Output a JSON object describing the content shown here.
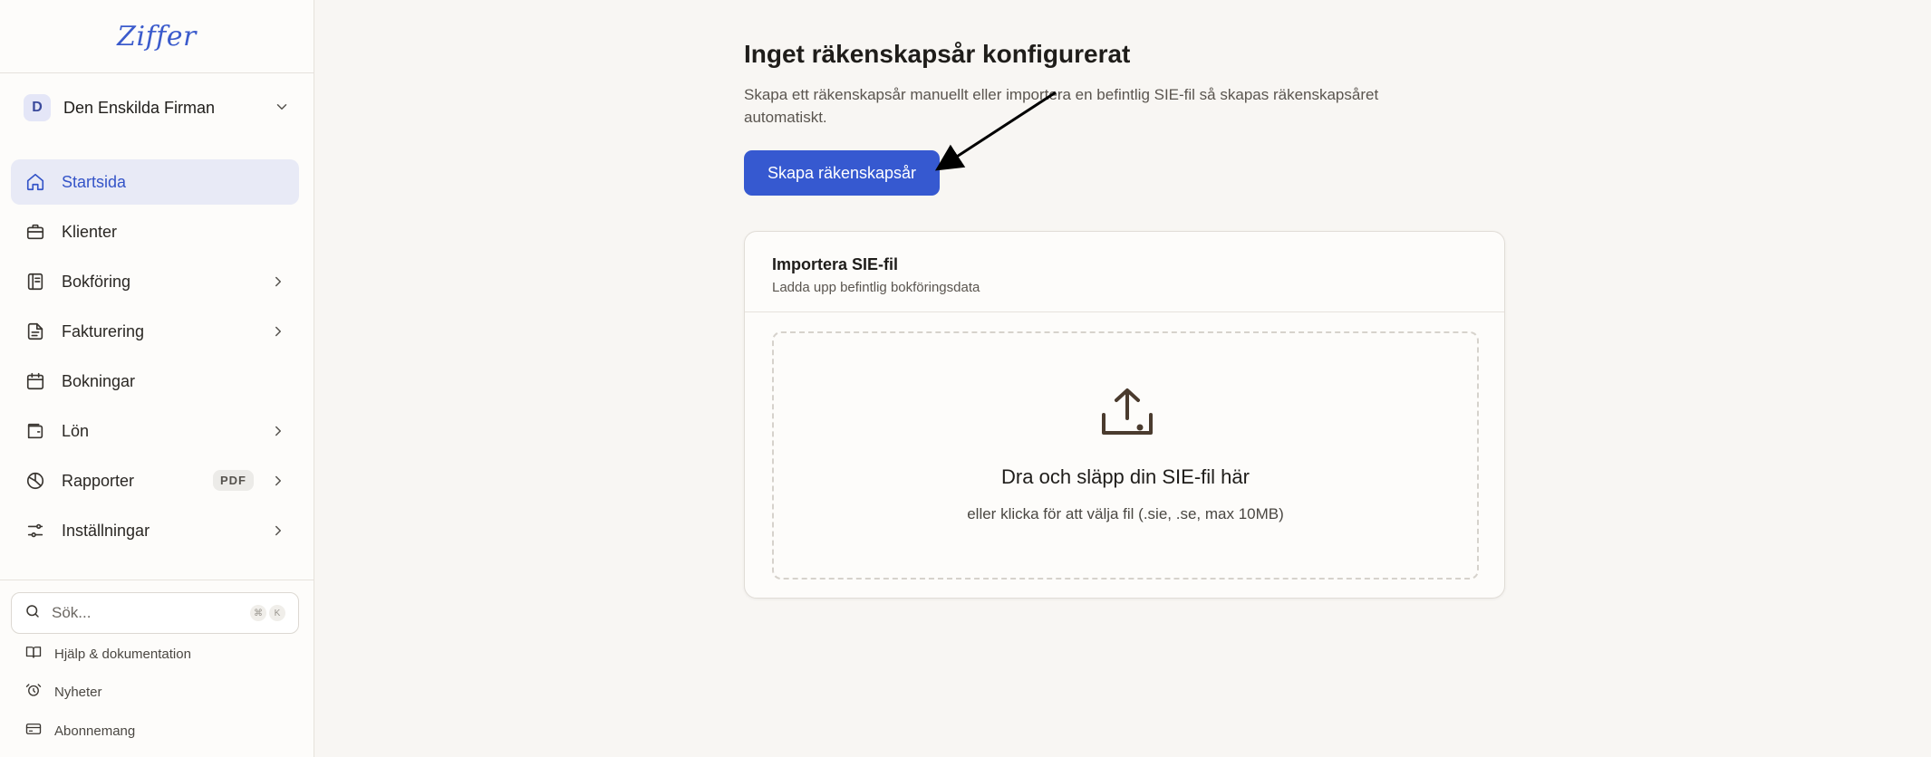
{
  "app": {
    "logo": "Ziffer"
  },
  "company": {
    "initial": "D",
    "name": "Den Enskilda Firman"
  },
  "nav": {
    "items": [
      {
        "label": "Startsida",
        "icon": "home-icon",
        "active": true,
        "chevron": false
      },
      {
        "label": "Klienter",
        "icon": "briefcase-icon",
        "active": false,
        "chevron": false
      },
      {
        "label": "Bokföring",
        "icon": "ledger-icon",
        "active": false,
        "chevron": true
      },
      {
        "label": "Fakturering",
        "icon": "document-icon",
        "active": false,
        "chevron": true
      },
      {
        "label": "Bokningar",
        "icon": "calendar-icon",
        "active": false,
        "chevron": false
      },
      {
        "label": "Lön",
        "icon": "wallet-icon",
        "active": false,
        "chevron": true
      },
      {
        "label": "Rapporter",
        "icon": "pie-chart-icon",
        "active": false,
        "chevron": true,
        "badge": "PDF"
      },
      {
        "label": "Inställningar",
        "icon": "sliders-icon",
        "active": false,
        "chevron": true
      }
    ]
  },
  "search": {
    "placeholder": "Sök...",
    "shortcut": [
      "⌘",
      "K"
    ]
  },
  "footer": {
    "help": "Hjälp & dokumentation",
    "news": "Nyheter",
    "subscription": "Abonnemang"
  },
  "main": {
    "title": "Inget räkenskapsår konfigurerat",
    "description": "Skapa ett räkenskapsår manuellt eller importera en befintlig SIE-fil så skapas räkenskapsåret automatiskt.",
    "primary_button": "Skapa räkenskapsår"
  },
  "import_card": {
    "title": "Importera SIE-fil",
    "subtitle": "Ladda upp befintlig bokföringsdata",
    "drop_title": "Dra och släpp din SIE-fil här",
    "drop_subtitle": "eller klicka för att välja fil (.sie, .se, max 10MB)"
  },
  "colors": {
    "accent": "#3659d0",
    "active_nav_bg": "#e8eaf6",
    "background": "#f8f6f3",
    "sidebar": "#fdfcfa"
  }
}
